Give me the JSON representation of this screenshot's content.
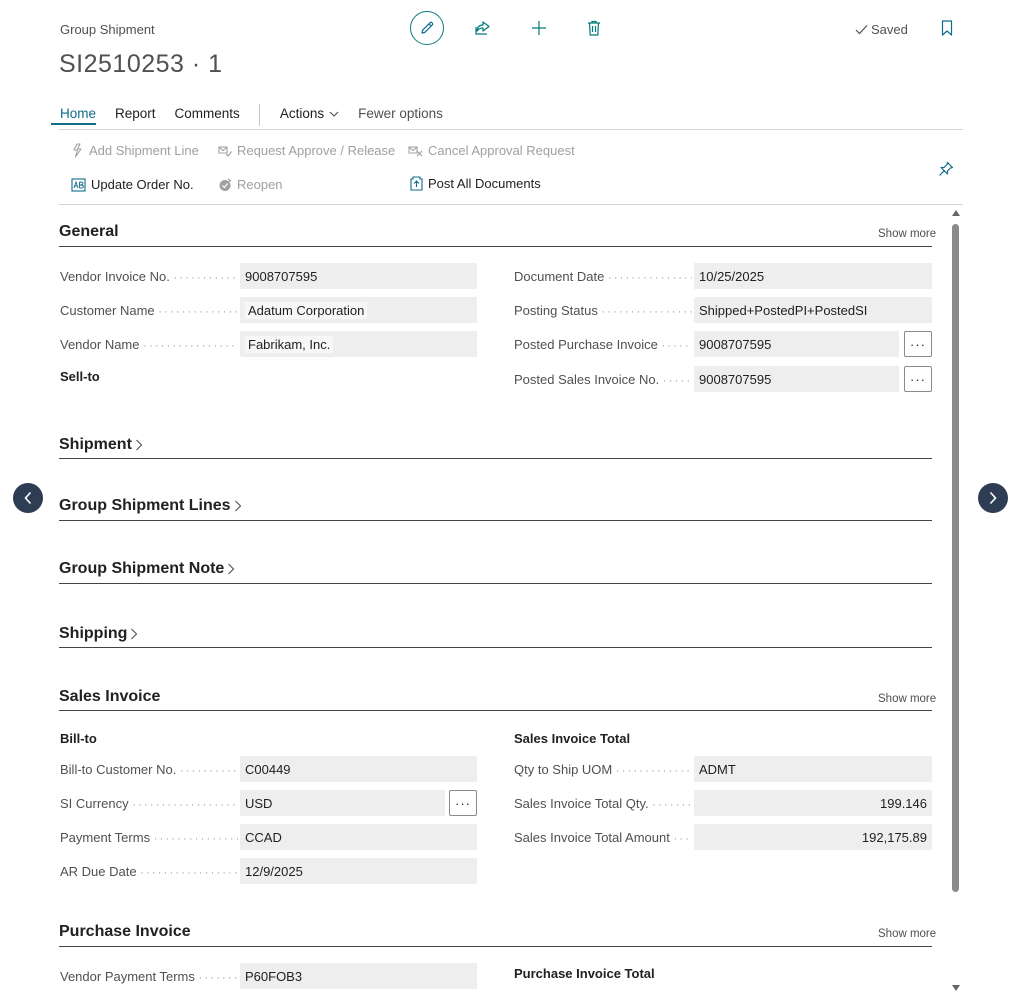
{
  "header": {
    "subtitle": "Group Shipment",
    "title": "SI2510253 · 1",
    "saved_label": "Saved"
  },
  "menu": {
    "items": [
      "Home",
      "Report",
      "Comments",
      "Actions",
      "Fewer options"
    ]
  },
  "actions": {
    "add_shipment_line": "Add Shipment Line",
    "request_approve": "Request Approve / Release",
    "cancel_approval": "Cancel Approval Request",
    "update_order": "Update Order No.",
    "reopen": "Reopen",
    "post_all": "Post All Documents"
  },
  "show_more_label": "Show more",
  "general": {
    "title": "General",
    "vendor_invoice_no": {
      "label": "Vendor Invoice No.",
      "value": "9008707595"
    },
    "customer_name": {
      "label": "Customer Name",
      "value": "Adatum Corporation"
    },
    "vendor_name": {
      "label": "Vendor Name",
      "value": "Fabrikam, Inc."
    },
    "sell_to": "Sell-to",
    "document_date": {
      "label": "Document Date",
      "value": "10/25/2025"
    },
    "posting_status": {
      "label": "Posting Status",
      "value": "Shipped+PostedPI+PostedSI"
    },
    "posted_purchase_invoice": {
      "label": "Posted Purchase Invoice",
      "value": "9008707595"
    },
    "posted_sales_invoice_no": {
      "label": "Posted Sales Invoice No.",
      "value": "9008707595"
    }
  },
  "collapsed_sections": {
    "shipment": "Shipment",
    "group_shipment_lines": "Group Shipment Lines",
    "group_shipment_note": "Group Shipment Note",
    "shipping": "Shipping"
  },
  "sales_invoice": {
    "title": "Sales Invoice",
    "bill_to": "Bill-to",
    "bill_to_customer_no": {
      "label": "Bill-to Customer No.",
      "value": "C00449"
    },
    "si_currency": {
      "label": "SI Currency",
      "value": "USD"
    },
    "payment_terms": {
      "label": "Payment Terms",
      "value": "CCAD"
    },
    "ar_due_date": {
      "label": "AR Due Date",
      "value": "12/9/2025"
    },
    "total_group": "Sales Invoice Total",
    "qty_to_ship_uom": {
      "label": "Qty to Ship UOM",
      "value": "ADMT"
    },
    "total_qty": {
      "label": "Sales Invoice Total Qty.",
      "value": "199.146"
    },
    "total_amount": {
      "label": "Sales Invoice Total Amount",
      "value": "192,175.89"
    }
  },
  "purchase_invoice": {
    "title": "Purchase Invoice",
    "vendor_payment_terms": {
      "label": "Vendor Payment Terms",
      "value": "P60FOB3"
    },
    "total_group": "Purchase Invoice Total"
  },
  "colors": {
    "accent": "#0f6c8b",
    "teal": "#007a78",
    "nav_button": "#2f3d54",
    "field_bg": "#eeeeee"
  }
}
